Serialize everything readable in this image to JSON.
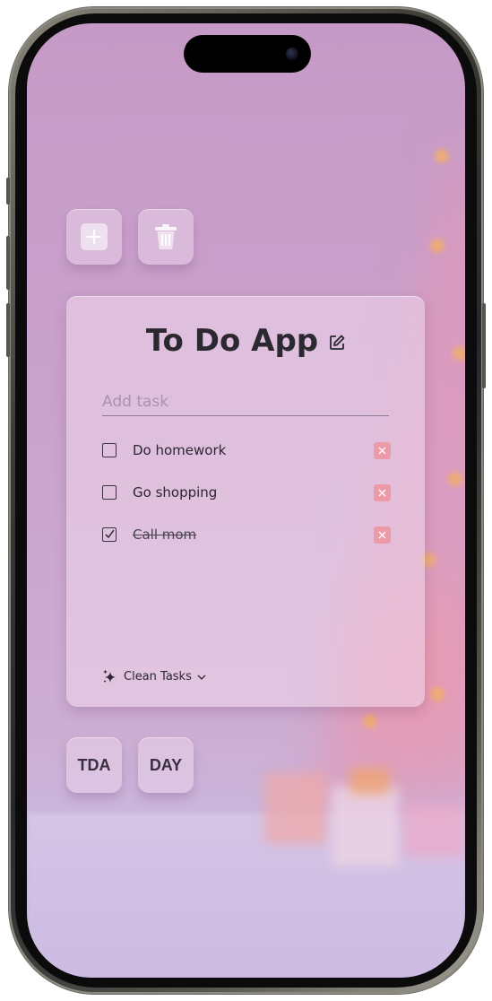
{
  "toolbar": {
    "add_icon": "plus-square-icon",
    "delete_icon": "trash-icon"
  },
  "card": {
    "title": "To Do App",
    "add_placeholder": "Add task",
    "tasks": [
      {
        "label": "Do homework",
        "done": false
      },
      {
        "label": "Go shopping",
        "done": false
      },
      {
        "label": "Call mom",
        "done": true
      }
    ],
    "clean_label": "Clean Tasks"
  },
  "bottom_buttons": {
    "tda_label": "TDA",
    "day_label": "DAY"
  },
  "colors": {
    "delete_button": "#ec9aa8",
    "title_text": "#2c2830"
  }
}
